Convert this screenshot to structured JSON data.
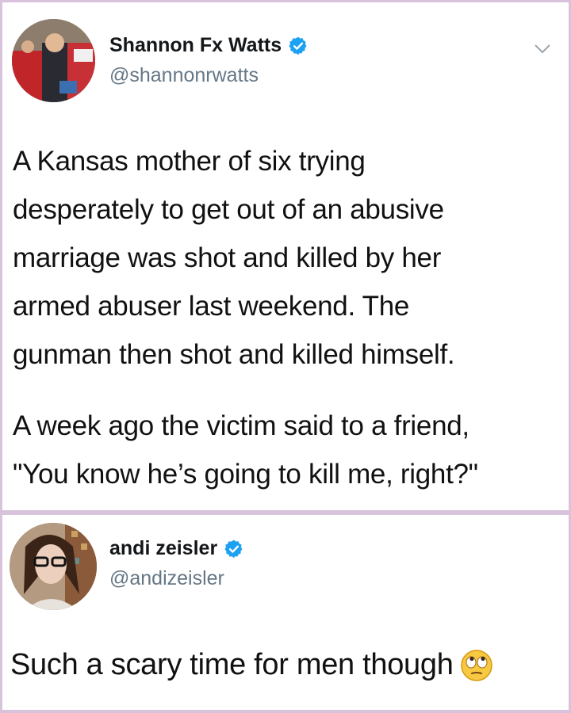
{
  "tweets": [
    {
      "display_name": "Shannon Fx Watts",
      "handle": "@shannonrwatts",
      "verified": true,
      "paragraphs": [
        "A Kansas mother of six trying\ndesperately to get out of an abusive\nmarriage was shot and killed by her\narmed abuser last weekend. The\ngunman then shot and killed himself.",
        "A week ago the victim said to a friend,\n\"You know he’s going to kill me, right?\""
      ]
    },
    {
      "display_name": "andi zeisler",
      "handle": "@andizeisler",
      "verified": true,
      "text": "Such a scary time for men though",
      "emoji": "eye-roll-emoji"
    }
  ],
  "colors": {
    "background_frame": "#d9c3dc",
    "verified_badge": "#1da1f2",
    "handle_gray": "#657786"
  }
}
